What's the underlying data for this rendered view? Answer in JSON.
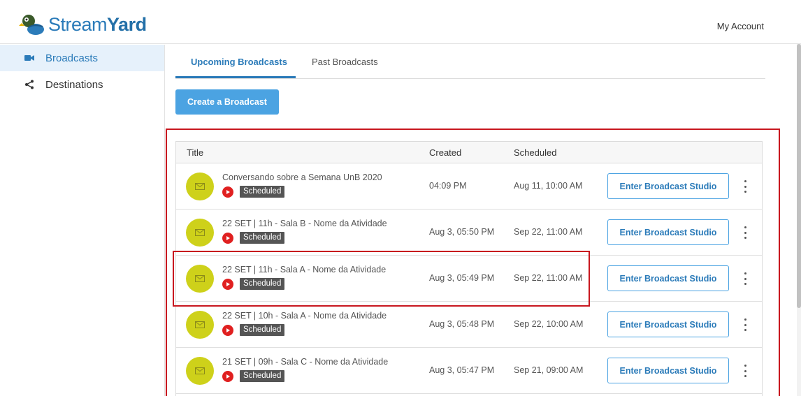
{
  "header": {
    "logo_text_light": "Stream",
    "logo_text_bold": "Yard",
    "my_account": "My Account"
  },
  "sidebar": {
    "items": [
      {
        "label": "Broadcasts",
        "icon": "video-camera-icon",
        "active": true
      },
      {
        "label": "Destinations",
        "icon": "share-icon",
        "active": false
      }
    ]
  },
  "tabs": [
    {
      "label": "Upcoming Broadcasts",
      "active": true
    },
    {
      "label": "Past Broadcasts",
      "active": false
    }
  ],
  "create_button": "Create a Broadcast",
  "table": {
    "headers": {
      "title": "Title",
      "created": "Created",
      "scheduled": "Scheduled"
    },
    "rows": [
      {
        "title": "Conversando sobre a Semana UnB 2020",
        "status": "Scheduled",
        "created": "04:09 PM",
        "scheduled": "Aug 11, 10:00 AM",
        "action": "Enter Broadcast Studio"
      },
      {
        "title": "22 SET | 11h - Sala B - Nome da Atividade",
        "status": "Scheduled",
        "created": "Aug 3, 05:50 PM",
        "scheduled": "Sep 22, 11:00 AM",
        "action": "Enter Broadcast Studio"
      },
      {
        "title": "22 SET | 11h - Sala A - Nome da Atividade",
        "status": "Scheduled",
        "created": "Aug 3, 05:49 PM",
        "scheduled": "Sep 22, 11:00 AM",
        "action": "Enter Broadcast Studio"
      },
      {
        "title": "22 SET | 10h - Sala A - Nome da Atividade",
        "status": "Scheduled",
        "created": "Aug 3, 05:48 PM",
        "scheduled": "Sep 22, 10:00 AM",
        "action": "Enter Broadcast Studio"
      },
      {
        "title": "21 SET | 09h - Sala C - Nome da Atividade",
        "status": "Scheduled",
        "created": "Aug 3, 05:47 PM",
        "scheduled": "Sep 21, 09:00 AM",
        "action": "Enter Broadcast Studio"
      }
    ]
  },
  "colors": {
    "accent": "#2b7bb9",
    "button_fill": "#4ba3e2",
    "avatar": "#ced11a",
    "youtube": "#e02020",
    "annotation": "#c8171f"
  }
}
